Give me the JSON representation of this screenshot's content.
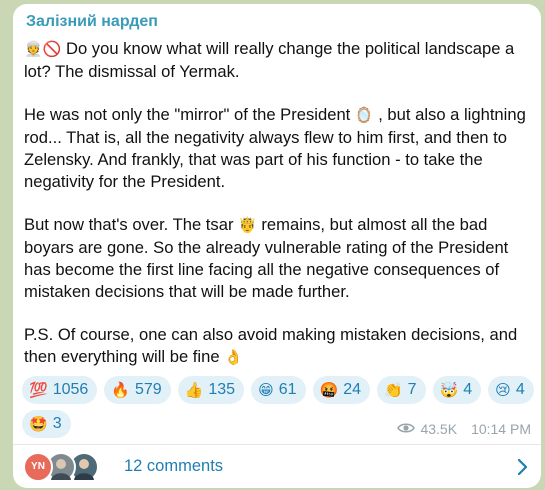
{
  "channel": {
    "name": "Залізний нардеп"
  },
  "post": {
    "paragraphs": [
      [
        {
          "t": "emoji",
          "v": "👳",
          "icon": "guard-face-icon"
        },
        {
          "t": "emoji",
          "v": "🚫",
          "icon": "no-entry-icon"
        },
        {
          "t": "text",
          "v": " Do you know what will really change the political landscape a lot? The dismissal of Yermak."
        }
      ],
      [
        {
          "t": "text",
          "v": "He was not only the \"mirror\" of the President "
        },
        {
          "t": "emoji",
          "v": "🪞",
          "icon": "mirror-icon"
        },
        {
          "t": "text",
          "v": " , but also a lightning rod... That is, all the negativity always flew to him first, and then to Zelensky. And frankly, that was part of his function - to take the negativity for the President."
        }
      ],
      [
        {
          "t": "text",
          "v": "But now that's over. The tsar "
        },
        {
          "t": "emoji",
          "v": "🤴",
          "icon": "prince-icon"
        },
        {
          "t": "text",
          "v": " remains, but almost all the bad boyars are gone. So the already vulnerable rating of the President has become the first line facing all the negative consequences of mistaken decisions that will be made further."
        }
      ],
      [
        {
          "t": "text",
          "v": "P.S. Of course, one can also avoid making mistaken decisions, and then everything will be fine "
        },
        {
          "t": "emoji",
          "v": "👌",
          "icon": "ok-hand-icon"
        }
      ]
    ]
  },
  "reactions": [
    {
      "emoji": "💯",
      "icon": "hundred-points-icon",
      "count": "1056"
    },
    {
      "emoji": "🔥",
      "icon": "fire-icon",
      "count": "579"
    },
    {
      "emoji": "👍",
      "icon": "thumbs-up-icon",
      "count": "135"
    },
    {
      "emoji": "😁",
      "icon": "grinning-face-icon",
      "count": "61"
    },
    {
      "emoji": "🤬",
      "icon": "cursing-face-icon",
      "count": "24"
    },
    {
      "emoji": "👏",
      "icon": "clapping-hands-icon",
      "count": "7"
    },
    {
      "emoji": "🤯",
      "icon": "exploding-head-icon",
      "count": "4"
    },
    {
      "emoji": "😢",
      "icon": "crying-face-icon",
      "count": "4"
    },
    {
      "emoji": "🤩",
      "icon": "star-struck-icon",
      "count": "3"
    }
  ],
  "meta": {
    "views": "43.5K",
    "time": "10:14 PM",
    "eye_icon": "eye-icon"
  },
  "comments": {
    "label": "12 comments",
    "avatars": [
      {
        "initials": "YN",
        "color": "#e86a5b"
      },
      {
        "initials": "",
        "color": "#7f8a8f"
      },
      {
        "initials": "",
        "color": "#4c6a78"
      }
    ]
  },
  "colors": {
    "accent": "#1f7fb2",
    "author": "#3a9bb8",
    "chip_bg": "#e2f0f8",
    "background": "#c9d7b4"
  }
}
